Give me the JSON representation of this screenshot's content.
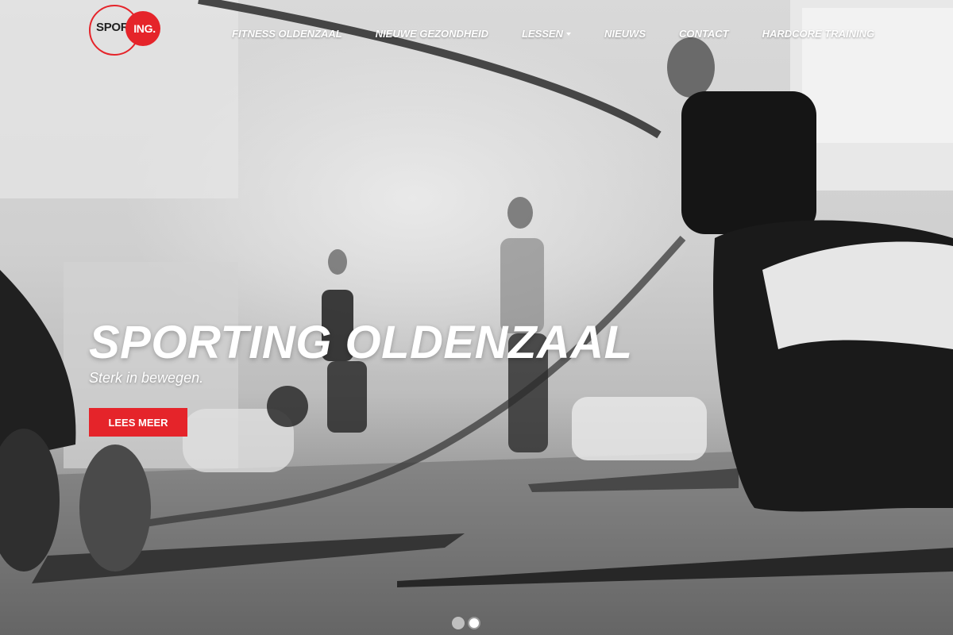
{
  "brand": {
    "logo_word": "SPORT",
    "logo_badge": "ING.",
    "accent_color": "#e5242a"
  },
  "nav": {
    "items": [
      {
        "label": "FITNESS OLDENZAAL"
      },
      {
        "label": "NIEUWE GEZONDHEID"
      },
      {
        "label": "LESSEN",
        "has_dropdown": true
      },
      {
        "label": "NIEUWS"
      },
      {
        "label": "CONTACT"
      },
      {
        "label": "HARDCORE TRAINING"
      }
    ]
  },
  "hero": {
    "title": "SPORTING OLDENZAAL",
    "subtitle": "Sterk in bewegen.",
    "cta_label": "LEES MEER"
  },
  "carousel": {
    "slide_count": 2,
    "active_index": 1
  }
}
